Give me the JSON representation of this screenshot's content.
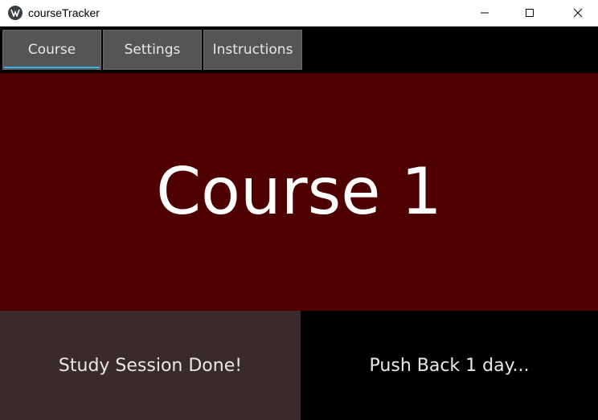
{
  "window": {
    "title": "courseTracker",
    "icon": "kivy-logo-icon"
  },
  "tabs": [
    {
      "label": "Course",
      "active": true
    },
    {
      "label": "Settings",
      "active": false
    },
    {
      "label": "Instructions",
      "active": false
    }
  ],
  "main": {
    "course_title": "Course 1"
  },
  "actions": {
    "done_label": "Study Session Done!",
    "push_label": "Push Back 1 day..."
  },
  "colors": {
    "course_panel": "#4e0000",
    "done_button": "#3a2b2b",
    "active_tab_indicator": "#33b5e5"
  }
}
